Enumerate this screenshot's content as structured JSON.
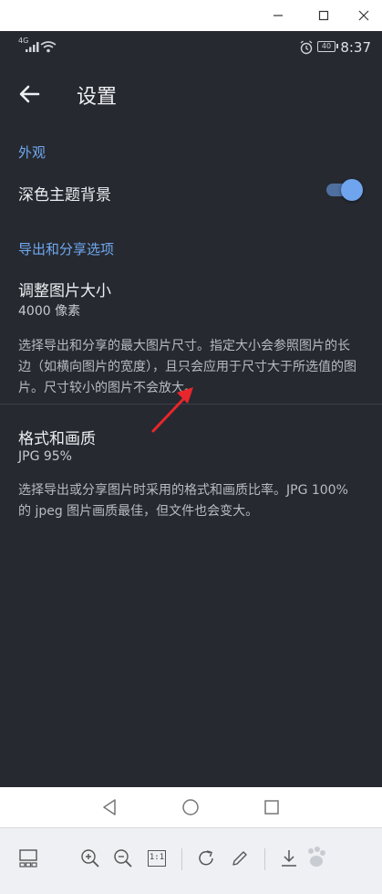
{
  "status_bar": {
    "signal_text": "4G",
    "battery": "40",
    "time": "8:37"
  },
  "appbar": {
    "title": "设置"
  },
  "appearance": {
    "section_label": "外观",
    "dark_theme_label": "深色主题背景",
    "dark_theme_on": true
  },
  "export": {
    "section_label": "导出和分享选项",
    "resize": {
      "title": "调整图片大小",
      "value": "4000 像素",
      "description": "选择导出和分享的最大图片尺寸。指定大小会参照图片的长边（如横向图片的宽度），且只会应用于尺寸大于所选值的图片。尺寸较小的图片不会放大。"
    },
    "format": {
      "title": "格式和画质",
      "value": "JPG 95%",
      "description": "选择导出或分享图片时采用的格式和画质比率。JPG 100% 的 jpeg 图片画质最佳，但文件也会变大。"
    }
  },
  "toolbar": {
    "actual_size_label": "1:1"
  },
  "colors": {
    "screen_bg": "#262930",
    "accent": "#6fa8f0",
    "annotation_arrow": "#e8262b"
  }
}
